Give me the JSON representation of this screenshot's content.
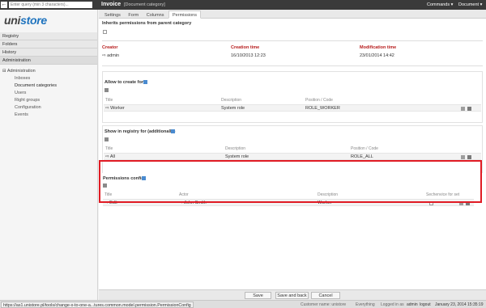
{
  "topbar": {
    "back_label": "←",
    "search_placeholder": "Enter query (min 3 characters)...",
    "title": "Invoice",
    "subtitle": "[Document category]",
    "menu_commands": "Commands ▾",
    "menu_document": "Document ▾"
  },
  "sidebar": {
    "logo_a": "uni",
    "logo_b": "store",
    "sections": [
      "Registry",
      "Folders",
      "History",
      "Administration"
    ],
    "tree_root": "⊟ Administration",
    "tree_items": [
      "Inboxes",
      "Document categories",
      "Users",
      "Right groups",
      "Configuration",
      "Events"
    ]
  },
  "tabs": [
    "Settings",
    "Form",
    "Columns",
    "Permissions"
  ],
  "inherit": {
    "label": "Inherits permissions from parent category"
  },
  "meta": {
    "creator_label": "Creator",
    "creator_value": "⇨ admin",
    "creation_label": "Creation time",
    "creation_value": "16/10/2013 12:23",
    "modification_label": "Modification time",
    "modification_value": "23/01/2014 14:42"
  },
  "allow_create": {
    "heading": "Allow to create for",
    "columns": [
      "Title",
      "Description",
      "Position / Code"
    ],
    "row": {
      "title": "⇨ Worker",
      "description": "System role",
      "code": "ROLE_WORKER"
    }
  },
  "show_registry": {
    "heading": "Show in registry for (additionally)",
    "columns": [
      "Title",
      "Description",
      "Position / Code"
    ],
    "row": {
      "title": "⇨ All",
      "description": "System role",
      "code": "ROLE_ALL"
    }
  },
  "permissions_config": {
    "heading": "Permissions config",
    "columns": [
      "Title",
      "Actor",
      "Description",
      "Sechenvice for set"
    ],
    "row": {
      "title": "⇨ Edit",
      "actor": "⇨ John Smith",
      "description": "Worker"
    }
  },
  "buttons": {
    "save": "Save",
    "save_back": "Save and back",
    "cancel": "Cancel"
  },
  "status": {
    "url": "https://as1.unistore.pl/tools/change-x-to-one-a...tures.common.model.permission.PermissionConfig",
    "customer": "Customer name: unistore",
    "everything": "Everything",
    "logged_prefix": "Logged in as",
    "user": "admin",
    "logout": "logout",
    "datetime": "January 23, 2014 15:35:19"
  },
  "colors": {
    "accent": "#1e73be",
    "highlight": "#e01b24",
    "label_red": "#b71c1c"
  }
}
